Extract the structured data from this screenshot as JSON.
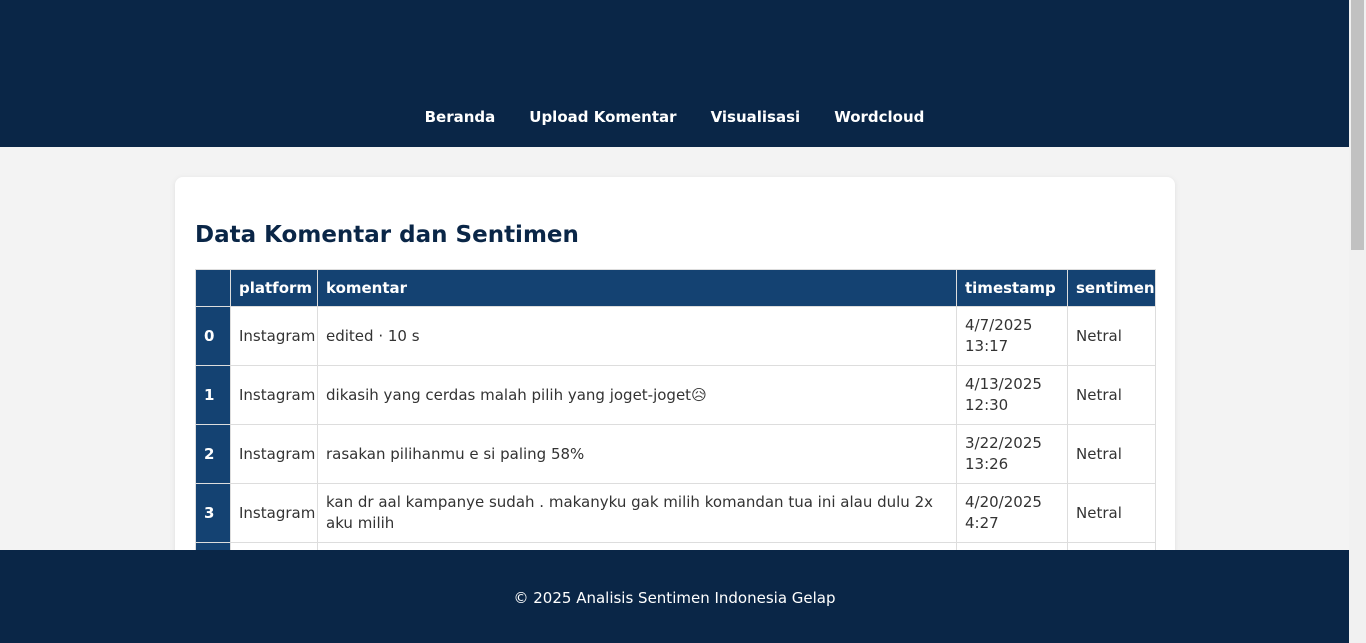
{
  "nav": {
    "items": [
      {
        "label": "Beranda"
      },
      {
        "label": "Upload Komentar"
      },
      {
        "label": "Visualisasi"
      },
      {
        "label": "Wordcloud"
      }
    ]
  },
  "main": {
    "title": "Data Komentar dan Sentimen",
    "table": {
      "headers": [
        "",
        "platform",
        "komentar",
        "timestamp",
        "sentimen"
      ],
      "rows": [
        {
          "index": "0",
          "platform": "Instagram",
          "komentar": "edited · 10 s",
          "timestamp": "4/7/2025 13:17",
          "sentimen": "Netral"
        },
        {
          "index": "1",
          "platform": "Instagram",
          "komentar": "dikasih yang cerdas malah pilih yang joget-joget😥",
          "timestamp": "4/13/2025 12:30",
          "sentimen": "Netral"
        },
        {
          "index": "2",
          "platform": "Instagram",
          "komentar": "rasakan pilihanmu e si paling 58%",
          "timestamp": "3/22/2025 13:26",
          "sentimen": "Netral"
        },
        {
          "index": "3",
          "platform": "Instagram",
          "komentar": "kan dr aal kampanye sudah . makanyku gak milih komandan tua ini alau dulu 2x aku milih",
          "timestamp": "4/20/2025 4:27",
          "sentimen": "Netral"
        },
        {
          "index": "",
          "platform": "",
          "komentar": "",
          "timestamp": "",
          "sentimen": ""
        }
      ]
    }
  },
  "footer": {
    "text": "© 2025 Analisis Sentimen Indonesia Gelap"
  },
  "colors": {
    "header_bg": "#0a2647",
    "table_header_bg": "#144272",
    "title_color": "#0a2647"
  }
}
